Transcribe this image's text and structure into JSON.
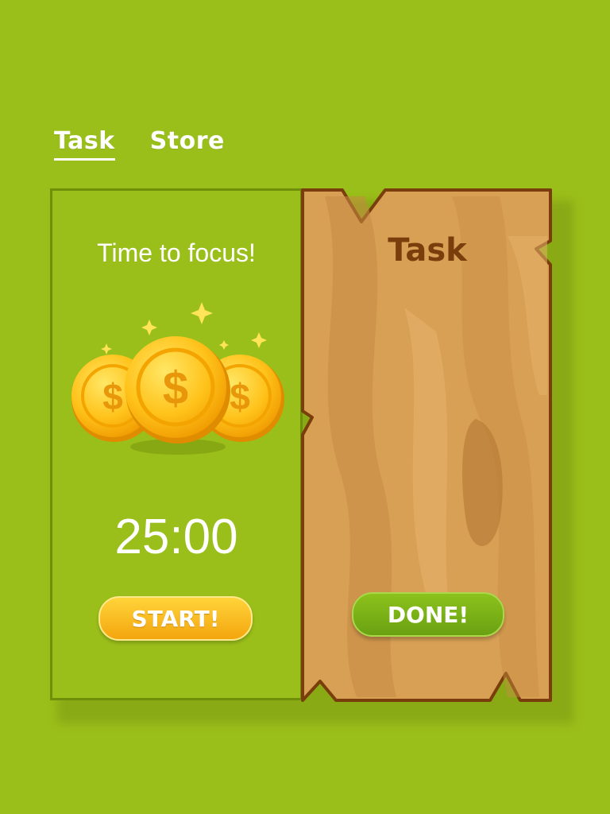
{
  "tabs": [
    {
      "label": "Task",
      "active": true
    },
    {
      "label": "Store",
      "active": false
    }
  ],
  "focus_panel": {
    "title": "Time to focus!",
    "timer": "25:00",
    "start_label": "START!",
    "coin_symbol": "$"
  },
  "task_panel": {
    "title": "Task",
    "done_label": "DONE!"
  },
  "colors": {
    "background": "#9bbf1a",
    "panel_border": "#6f8e0a",
    "wood": "#d89a52",
    "wood_border": "#7a3e0c",
    "start_button": "#f7b21a",
    "done_button": "#7db317"
  }
}
